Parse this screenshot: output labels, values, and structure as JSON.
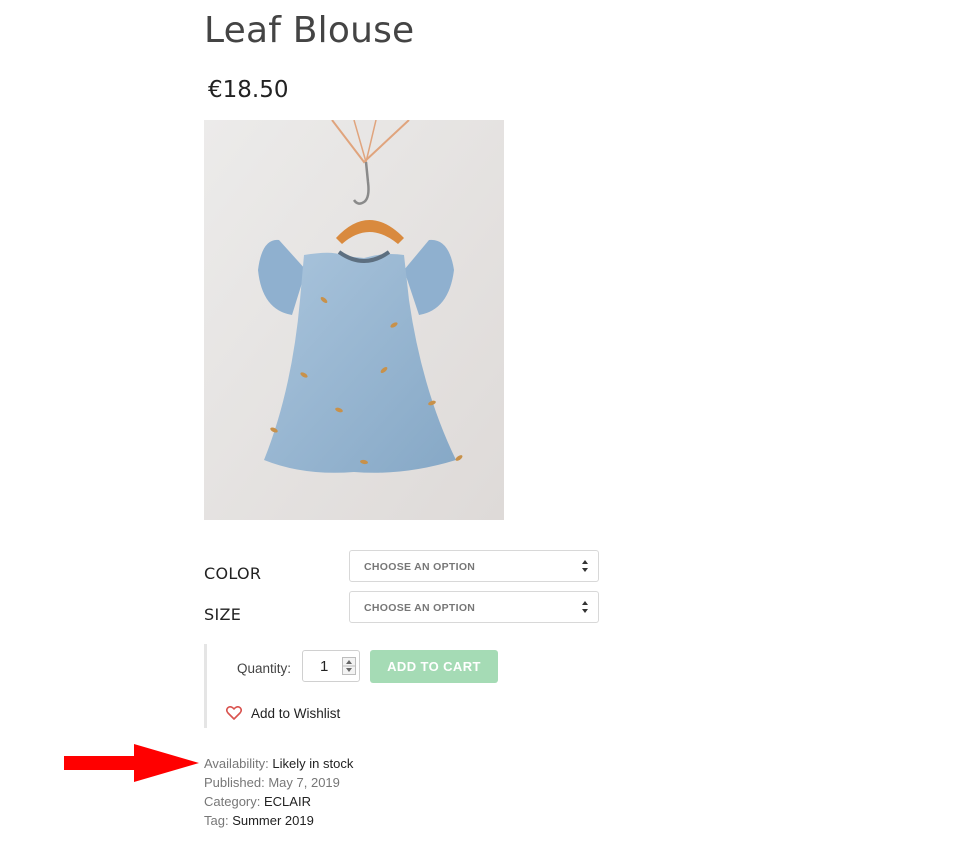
{
  "product": {
    "title": "Leaf Blouse",
    "price": "€18.50",
    "image_alt": "Light blue blouse with flutter sleeves on a wooden hanger"
  },
  "variations": [
    {
      "label": "COLOR",
      "placeholder": "CHOOSE AN OPTION"
    },
    {
      "label": "SIZE",
      "placeholder": "CHOOSE AN OPTION"
    }
  ],
  "cart": {
    "quantity_label": "Quantity:",
    "quantity_value": "1",
    "add_to_cart_label": "ADD TO CART",
    "button_color": "#a5dbb5"
  },
  "wishlist": {
    "label": "Add to Wishlist",
    "icon": "heart-outline-icon",
    "icon_color": "#d9534f"
  },
  "meta": {
    "availability_label": "Availability:",
    "availability_value": "Likely in stock",
    "published_label": "Published:",
    "published_value": "May 7, 2019",
    "category_label": "Category:",
    "category_value": "ECLAIR",
    "tag_label": "Tag:",
    "tag_value": "Summer 2019"
  },
  "annotation": {
    "icon": "red-arrow-icon",
    "color": "#ff0000"
  }
}
